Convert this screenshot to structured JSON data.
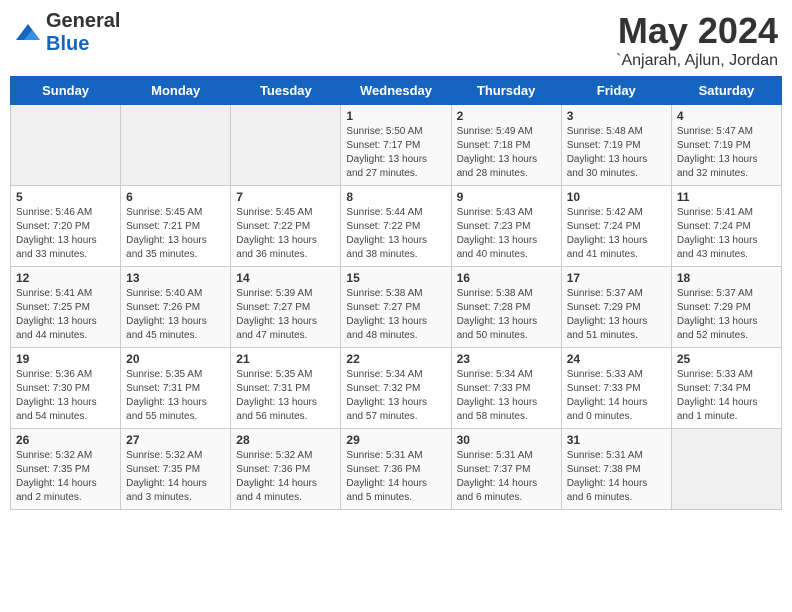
{
  "header": {
    "logo_general": "General",
    "logo_blue": "Blue",
    "month": "May 2024",
    "location": "`Anjarah, Ajlun, Jordan"
  },
  "days_of_week": [
    "Sunday",
    "Monday",
    "Tuesday",
    "Wednesday",
    "Thursday",
    "Friday",
    "Saturday"
  ],
  "weeks": [
    [
      {
        "day": "",
        "empty": true
      },
      {
        "day": "",
        "empty": true
      },
      {
        "day": "",
        "empty": true
      },
      {
        "day": "1",
        "sunrise": "5:50 AM",
        "sunset": "7:17 PM",
        "daylight": "13 hours and 27 minutes."
      },
      {
        "day": "2",
        "sunrise": "5:49 AM",
        "sunset": "7:18 PM",
        "daylight": "13 hours and 28 minutes."
      },
      {
        "day": "3",
        "sunrise": "5:48 AM",
        "sunset": "7:19 PM",
        "daylight": "13 hours and 30 minutes."
      },
      {
        "day": "4",
        "sunrise": "5:47 AM",
        "sunset": "7:19 PM",
        "daylight": "13 hours and 32 minutes."
      }
    ],
    [
      {
        "day": "5",
        "sunrise": "5:46 AM",
        "sunset": "7:20 PM",
        "daylight": "13 hours and 33 minutes."
      },
      {
        "day": "6",
        "sunrise": "5:45 AM",
        "sunset": "7:21 PM",
        "daylight": "13 hours and 35 minutes."
      },
      {
        "day": "7",
        "sunrise": "5:45 AM",
        "sunset": "7:22 PM",
        "daylight": "13 hours and 36 minutes."
      },
      {
        "day": "8",
        "sunrise": "5:44 AM",
        "sunset": "7:22 PM",
        "daylight": "13 hours and 38 minutes."
      },
      {
        "day": "9",
        "sunrise": "5:43 AM",
        "sunset": "7:23 PM",
        "daylight": "13 hours and 40 minutes."
      },
      {
        "day": "10",
        "sunrise": "5:42 AM",
        "sunset": "7:24 PM",
        "daylight": "13 hours and 41 minutes."
      },
      {
        "day": "11",
        "sunrise": "5:41 AM",
        "sunset": "7:24 PM",
        "daylight": "13 hours and 43 minutes."
      }
    ],
    [
      {
        "day": "12",
        "sunrise": "5:41 AM",
        "sunset": "7:25 PM",
        "daylight": "13 hours and 44 minutes."
      },
      {
        "day": "13",
        "sunrise": "5:40 AM",
        "sunset": "7:26 PM",
        "daylight": "13 hours and 45 minutes."
      },
      {
        "day": "14",
        "sunrise": "5:39 AM",
        "sunset": "7:27 PM",
        "daylight": "13 hours and 47 minutes."
      },
      {
        "day": "15",
        "sunrise": "5:38 AM",
        "sunset": "7:27 PM",
        "daylight": "13 hours and 48 minutes."
      },
      {
        "day": "16",
        "sunrise": "5:38 AM",
        "sunset": "7:28 PM",
        "daylight": "13 hours and 50 minutes."
      },
      {
        "day": "17",
        "sunrise": "5:37 AM",
        "sunset": "7:29 PM",
        "daylight": "13 hours and 51 minutes."
      },
      {
        "day": "18",
        "sunrise": "5:37 AM",
        "sunset": "7:29 PM",
        "daylight": "13 hours and 52 minutes."
      }
    ],
    [
      {
        "day": "19",
        "sunrise": "5:36 AM",
        "sunset": "7:30 PM",
        "daylight": "13 hours and 54 minutes."
      },
      {
        "day": "20",
        "sunrise": "5:35 AM",
        "sunset": "7:31 PM",
        "daylight": "13 hours and 55 minutes."
      },
      {
        "day": "21",
        "sunrise": "5:35 AM",
        "sunset": "7:31 PM",
        "daylight": "13 hours and 56 minutes."
      },
      {
        "day": "22",
        "sunrise": "5:34 AM",
        "sunset": "7:32 PM",
        "daylight": "13 hours and 57 minutes."
      },
      {
        "day": "23",
        "sunrise": "5:34 AM",
        "sunset": "7:33 PM",
        "daylight": "13 hours and 58 minutes."
      },
      {
        "day": "24",
        "sunrise": "5:33 AM",
        "sunset": "7:33 PM",
        "daylight": "14 hours and 0 minutes."
      },
      {
        "day": "25",
        "sunrise": "5:33 AM",
        "sunset": "7:34 PM",
        "daylight": "14 hours and 1 minute."
      }
    ],
    [
      {
        "day": "26",
        "sunrise": "5:32 AM",
        "sunset": "7:35 PM",
        "daylight": "14 hours and 2 minutes."
      },
      {
        "day": "27",
        "sunrise": "5:32 AM",
        "sunset": "7:35 PM",
        "daylight": "14 hours and 3 minutes."
      },
      {
        "day": "28",
        "sunrise": "5:32 AM",
        "sunset": "7:36 PM",
        "daylight": "14 hours and 4 minutes."
      },
      {
        "day": "29",
        "sunrise": "5:31 AM",
        "sunset": "7:36 PM",
        "daylight": "14 hours and 5 minutes."
      },
      {
        "day": "30",
        "sunrise": "5:31 AM",
        "sunset": "7:37 PM",
        "daylight": "14 hours and 6 minutes."
      },
      {
        "day": "31",
        "sunrise": "5:31 AM",
        "sunset": "7:38 PM",
        "daylight": "14 hours and 6 minutes."
      },
      {
        "day": "",
        "empty": true
      }
    ]
  ]
}
